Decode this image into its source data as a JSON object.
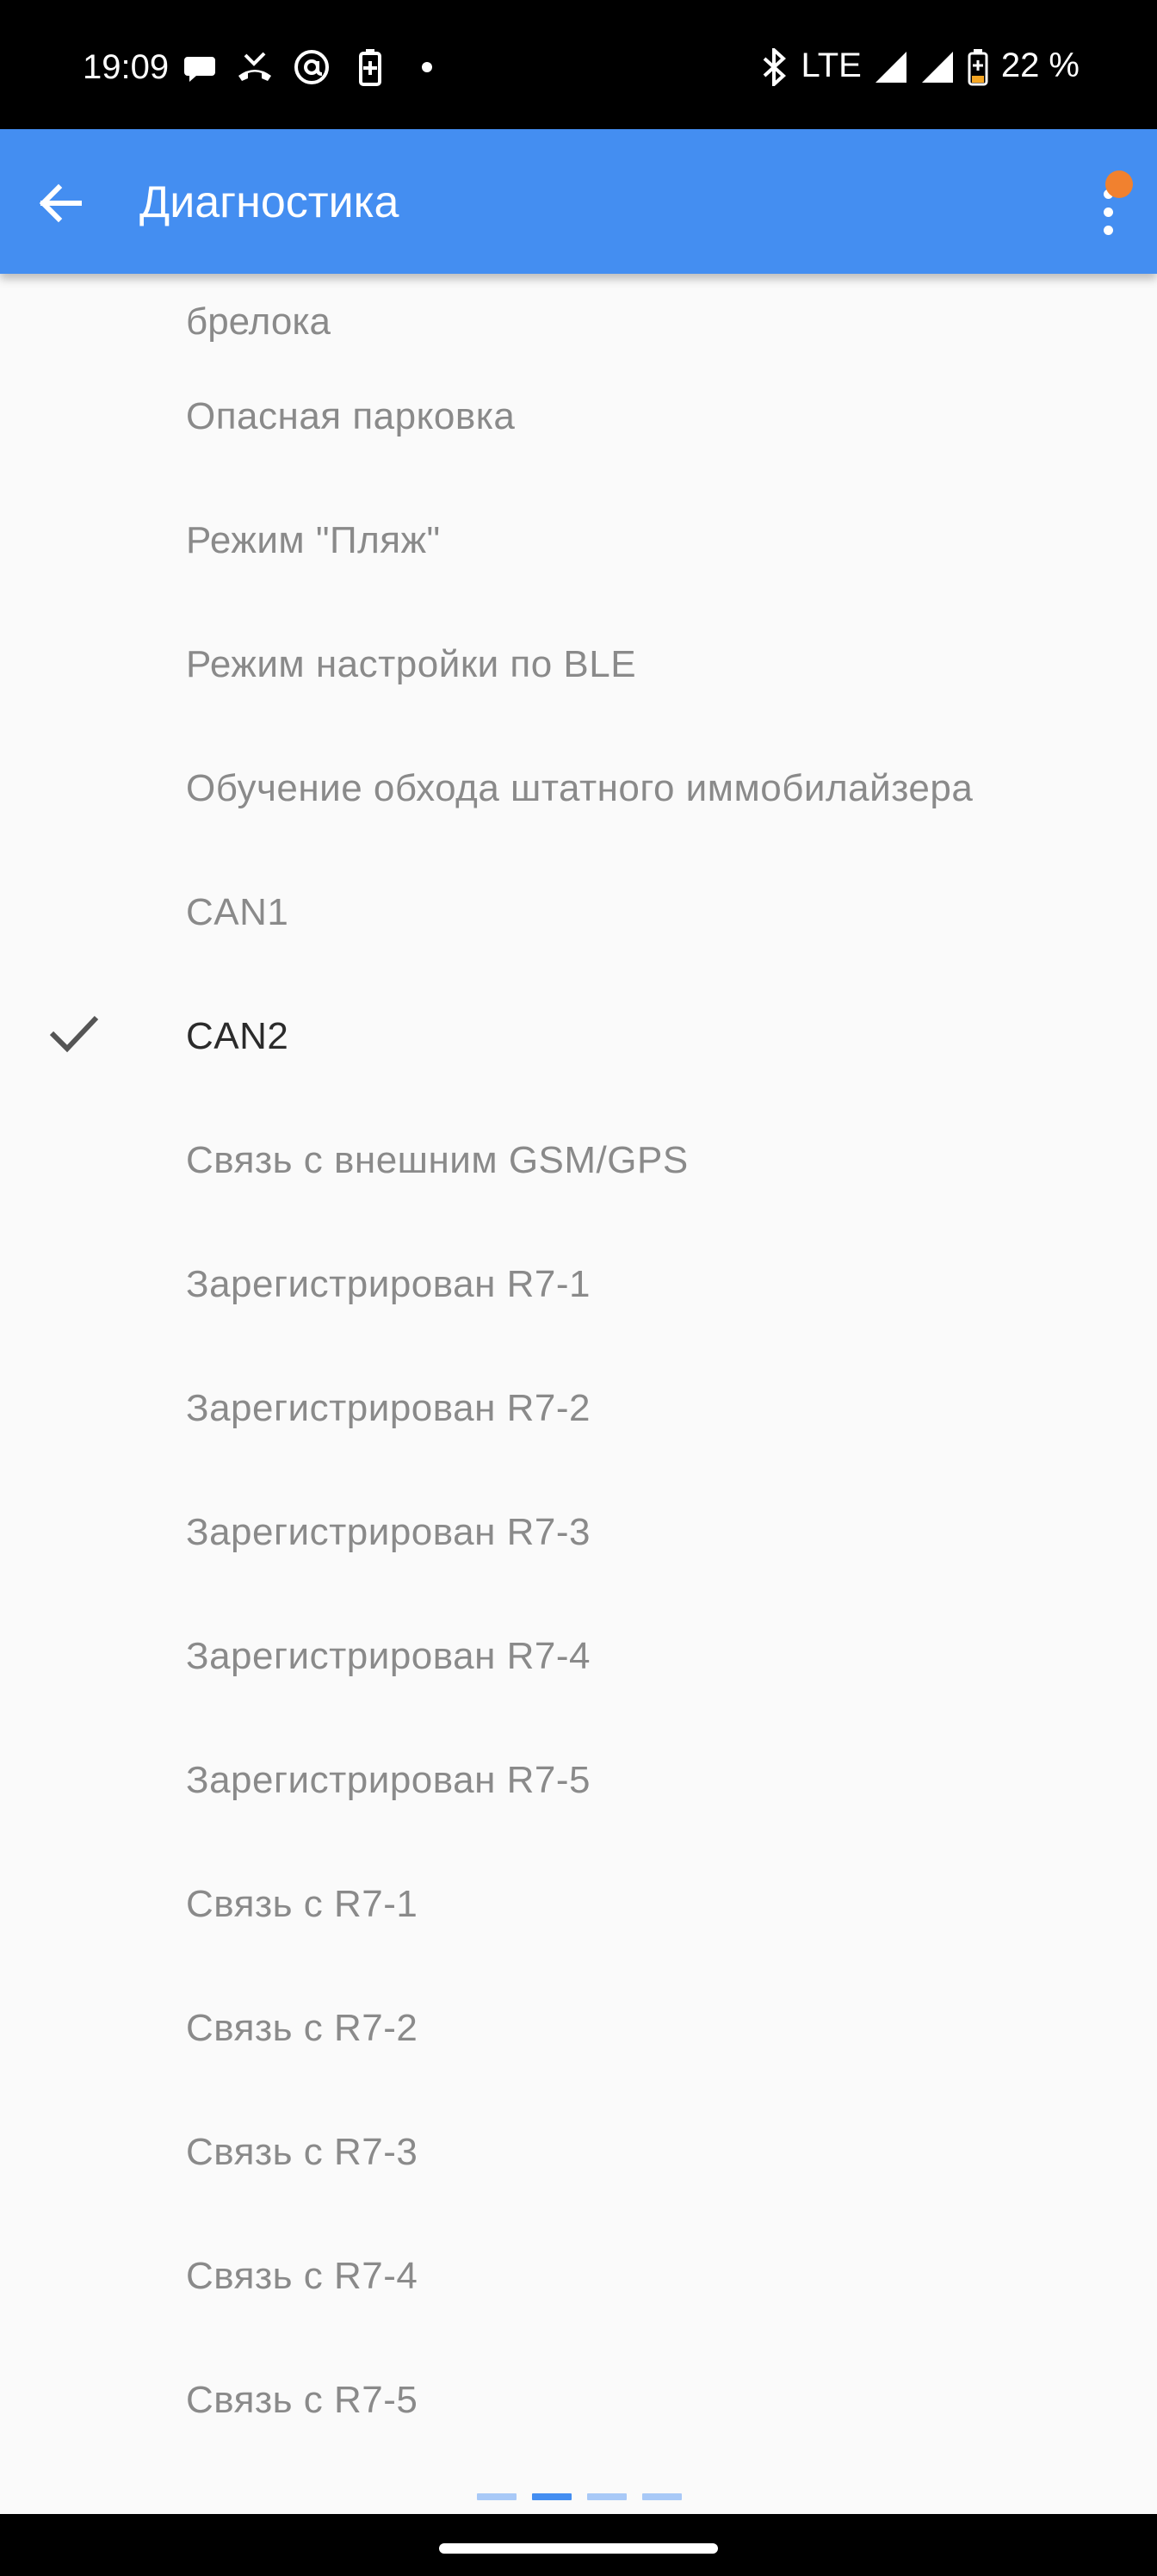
{
  "status_bar": {
    "time": "19:09",
    "network": "LTE",
    "battery": "22 %",
    "icons": [
      "chat-icon",
      "missed-call-icon",
      "at-sign-icon",
      "battery-saver-icon",
      "dot-icon",
      "bluetooth-icon",
      "signal-icon",
      "signal-icon",
      "battery-icon"
    ]
  },
  "app_bar": {
    "title": "Диагностика",
    "back_icon": "arrow-left-icon",
    "menu_icon": "more-vert-icon",
    "accent_color": "#448ef1",
    "notification_color": "#f1812f"
  },
  "list": {
    "partial_item_last_line": "брелока",
    "items": [
      {
        "label": "Опасная парковка",
        "checked": false
      },
      {
        "label": "Режим \"Пляж\"",
        "checked": false
      },
      {
        "label": "Режим настройки по BLE",
        "checked": false
      },
      {
        "label": "Обучение обхода штатного иммобилайзера",
        "checked": false
      },
      {
        "label": "CAN1",
        "checked": false
      },
      {
        "label": "CAN2",
        "checked": true
      },
      {
        "label": "Связь с внешним GSM/GPS",
        "checked": false
      },
      {
        "label": "Зарегистрирован R7-1",
        "checked": false
      },
      {
        "label": "Зарегистрирован R7-2",
        "checked": false
      },
      {
        "label": "Зарегистрирован R7-3",
        "checked": false
      },
      {
        "label": "Зарегистрирован R7-4",
        "checked": false
      },
      {
        "label": "Зарегистрирован R7-5",
        "checked": false
      },
      {
        "label": "Связь с R7-1",
        "checked": false
      },
      {
        "label": "Связь с R7-2",
        "checked": false
      },
      {
        "label": "Связь с R7-3",
        "checked": false
      },
      {
        "label": "Связь с R7-4",
        "checked": false
      },
      {
        "label": "Связь с R7-5",
        "checked": false
      }
    ]
  },
  "page_indicator": {
    "pages": 4,
    "current": 2
  }
}
